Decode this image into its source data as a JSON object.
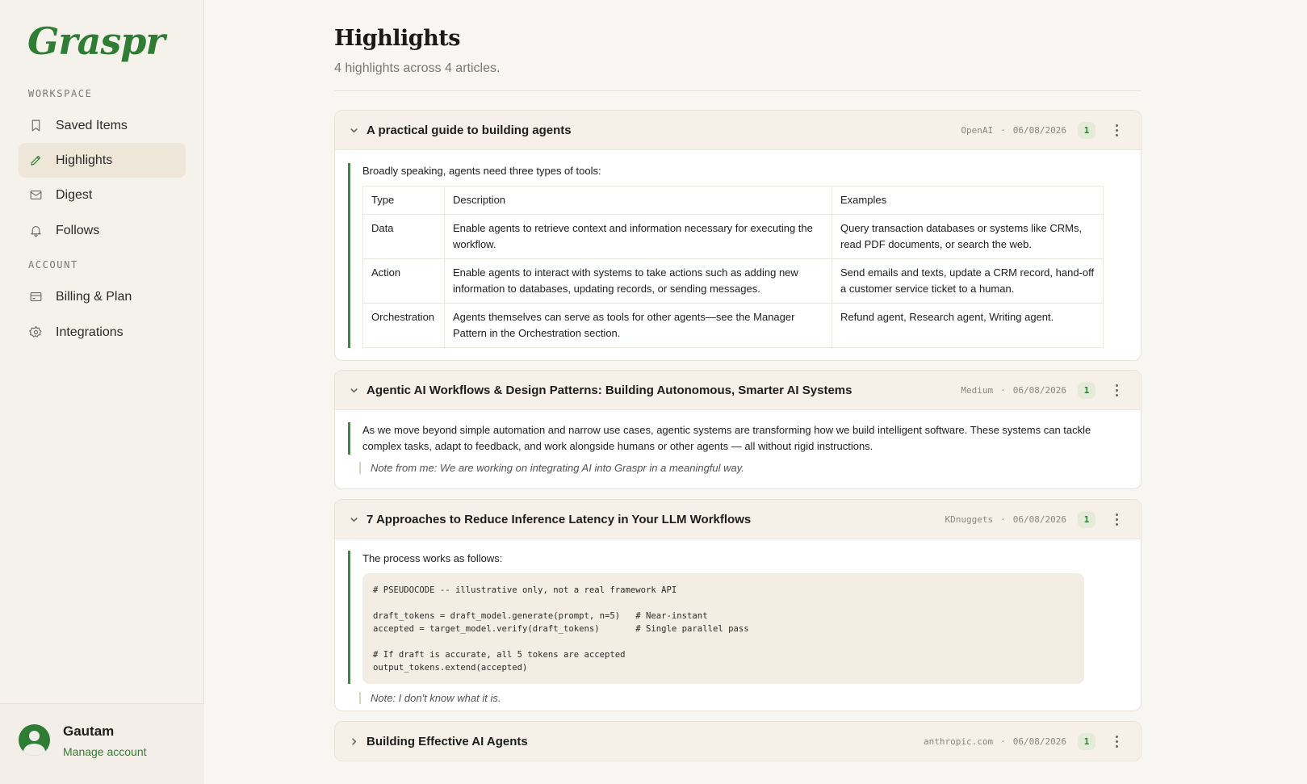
{
  "app": {
    "logo": "Graspr"
  },
  "sidebar": {
    "workspace_label": "WORKSPACE",
    "account_label": "ACCOUNT",
    "workspace_items": [
      {
        "label": "Saved Items",
        "icon": "bookmark-icon"
      },
      {
        "label": "Highlights",
        "icon": "pencil-icon",
        "active": true
      },
      {
        "label": "Digest",
        "icon": "mail-icon"
      },
      {
        "label": "Follows",
        "icon": "bell-icon"
      }
    ],
    "account_items": [
      {
        "label": "Billing & Plan",
        "icon": "credit-card-icon"
      },
      {
        "label": "Integrations",
        "icon": "gear-icon"
      }
    ],
    "user": {
      "name": "Gautam",
      "link": "Manage account"
    }
  },
  "page": {
    "title": "Highlights",
    "subtitle": "4 highlights across 4 articles."
  },
  "colors": {
    "accent": "#2f7d35",
    "highlight_bar": "#3a8a3f",
    "card_header": "#f6f0e8"
  },
  "articles": [
    {
      "title": "A practical guide to building agents",
      "source": "OpenAI",
      "date": "06/08/2026",
      "count": "1",
      "expanded": true,
      "highlight": "Broadly speaking, agents need three types of tools:",
      "table": {
        "headers": [
          "Type",
          "Description",
          "Examples"
        ],
        "rows": [
          [
            "Data",
            "Enable agents to retrieve context and information necessary for executing the workflow.",
            "Query transaction databases or systems like CRMs, read PDF documents, or search the web."
          ],
          [
            "Action",
            "Enable agents to interact with systems to take actions such as adding new information to databases, updating records, or sending messages.",
            "Send emails and texts, update a CRM record, hand-off a customer service ticket to a human."
          ],
          [
            "Orchestration",
            "Agents themselves can serve as tools for other agents—see the Manager Pattern in the Orchestration section.",
            "Refund agent, Research agent, Writing agent."
          ]
        ]
      }
    },
    {
      "title": "Agentic AI Workflows & Design Patterns: Building Autonomous, Smarter AI Systems",
      "source": "Medium",
      "date": "06/08/2026",
      "count": "1",
      "expanded": true,
      "highlight": "As we move beyond simple automation and narrow use cases, agentic systems are transforming how we build intelligent software. These systems can tackle complex tasks, adapt to feedback, and work alongside humans or other agents — all without rigid instructions.",
      "note": "Note from me: We are working on integrating AI into Graspr in a meaningful way."
    },
    {
      "title": "7 Approaches to Reduce Inference Latency in Your LLM Workflows",
      "source": "KDnuggets",
      "date": "06/08/2026",
      "count": "1",
      "expanded": true,
      "highlight": "The process works as follows:",
      "code": "# PSEUDOCODE -- illustrative only, not a real framework API\n\ndraft_tokens = draft_model.generate(prompt, n=5)   # Near-instant\naccepted = target_model.verify(draft_tokens)       # Single parallel pass\n\n# If draft is accurate, all 5 tokens are accepted\noutput_tokens.extend(accepted)",
      "note": "Note: I don't know what it is."
    },
    {
      "title": "Building Effective AI Agents",
      "source": "anthropic.com",
      "date": "06/08/2026",
      "count": "1",
      "expanded": false
    }
  ]
}
